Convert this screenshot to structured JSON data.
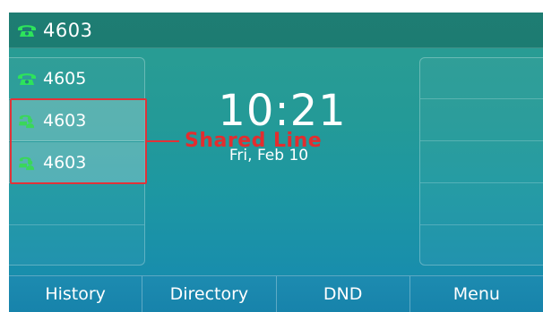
{
  "topbar": {
    "account": "4603",
    "icon": "phone-handset-icon"
  },
  "lines": [
    {
      "label": "4605",
      "icon": "phone-handset-icon",
      "highlighted": false
    },
    {
      "label": "4603",
      "icon": "shared-line-phone-icon",
      "highlighted": true
    },
    {
      "label": "4603",
      "icon": "shared-line-phone-icon",
      "highlighted": true
    }
  ],
  "clock": {
    "time": "10:21",
    "date": "Fri, Feb 10"
  },
  "annotation": {
    "text": "Shared Line",
    "color": "#e22d2f"
  },
  "softkeys": [
    "History",
    "Directory",
    "DND",
    "Menu"
  ],
  "colors": {
    "icon_green": "#28d14a",
    "accent_red": "#e13238"
  }
}
